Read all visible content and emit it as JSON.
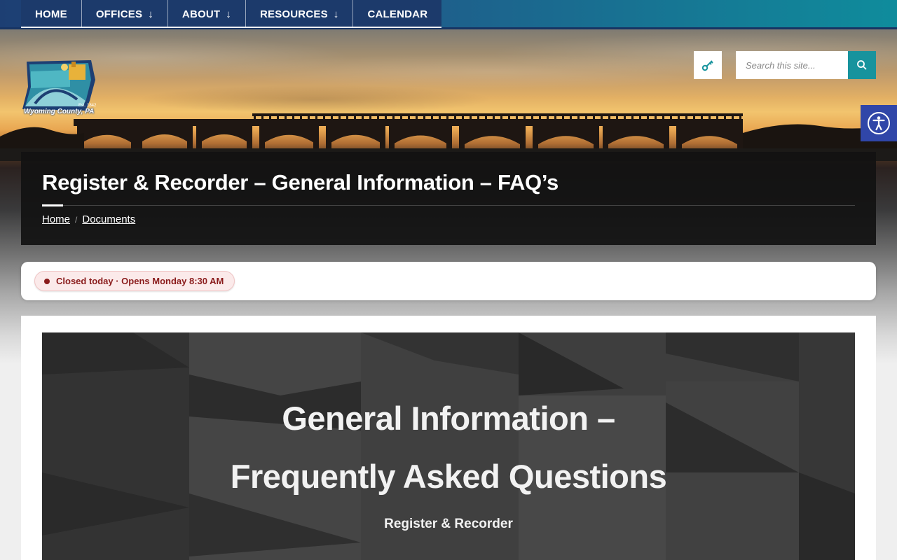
{
  "nav": {
    "items": [
      {
        "label": "HOME",
        "has_dropdown": false
      },
      {
        "label": "OFFICES",
        "has_dropdown": true
      },
      {
        "label": "ABOUT",
        "has_dropdown": true
      },
      {
        "label": "RESOURCES",
        "has_dropdown": true
      },
      {
        "label": "CALENDAR",
        "has_dropdown": false
      }
    ],
    "dropdown_icon": "arrow-down-icon"
  },
  "logo": {
    "text": "Wyoming County, PA",
    "est": "Est. 1842"
  },
  "search": {
    "placeholder": "Search this site...",
    "icon": "search-icon"
  },
  "login_icon": "key-icon",
  "accessibility_icon": "accessibility-icon",
  "page": {
    "title": "Register & Recorder – General Information – FAQ’s",
    "breadcrumb": [
      {
        "label": "Home"
      },
      {
        "label": "Documents"
      }
    ]
  },
  "status": {
    "text": "Closed today · Opens Monday 8:30 AM",
    "color": "#8a1c1c"
  },
  "banner": {
    "title_line1": "General Information –",
    "title_line2": "Frequently Asked Questions",
    "subtitle": "Register & Recorder"
  },
  "colors": {
    "nav_bg": "#1c3a6b",
    "search_button": "#17939d",
    "accessibility_button": "#3046a8",
    "title_panel": "#121212"
  }
}
